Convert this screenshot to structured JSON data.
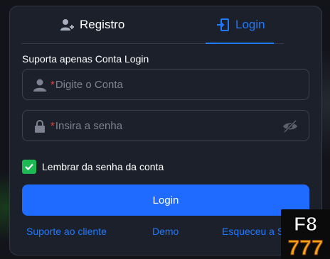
{
  "tabs": {
    "registro_label": "Registro",
    "login_label": "Login"
  },
  "form": {
    "subtitle": "Suporta apenas Conta Login",
    "conta_required_mark": "*",
    "conta_placeholder": "Digite o Conta",
    "senha_required_mark": "*",
    "senha_placeholder": "Insira a senha",
    "remember_label": "Lembrar da senha da conta",
    "remember_checked": true,
    "login_button": "Login"
  },
  "links": {
    "suporte": "Suporte ao cliente",
    "demo": "Demo",
    "esqueceu": "Esqueceu a S"
  },
  "logo": {
    "top": "F8",
    "bottom": "777"
  },
  "colors": {
    "accent": "#1f7aff",
    "button": "#1f6bff",
    "check": "#1db954",
    "required": "#e0453b"
  }
}
